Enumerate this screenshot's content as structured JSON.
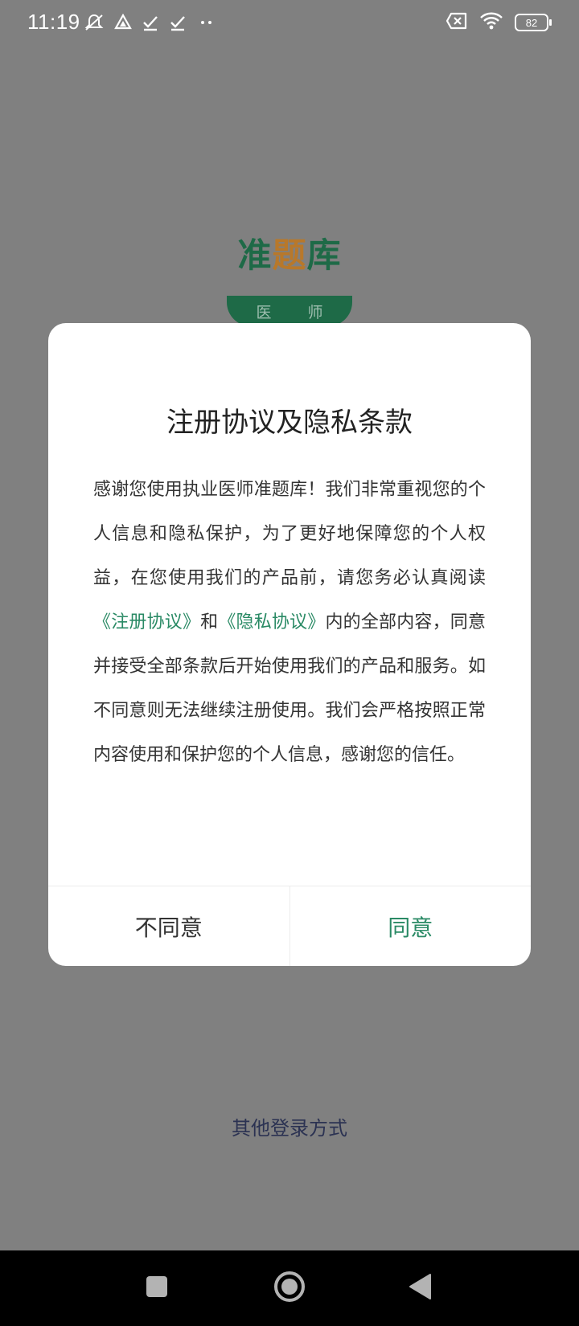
{
  "status_bar": {
    "time": "11:19",
    "battery": "82",
    "icons": [
      "mute-icon",
      "drive-icon",
      "check-icon",
      "check-icon",
      "more-dots-icon",
      "sim-error-icon",
      "wifi-icon",
      "battery-icon"
    ]
  },
  "logo": {
    "text_a": "准",
    "text_b": "题",
    "text_c": "库",
    "badge_left": "医",
    "badge_right": "师"
  },
  "dialog": {
    "title": "注册协议及隐私条款",
    "body_part1": "感谢您使用执业医师准题库！我们非常重视您的个人信息和隐私保护，为了更好地保障您的个人权益，在您使用我们的产品前，请您务必认真阅读",
    "link_register": "《注册协议》",
    "body_and": "和",
    "link_privacy": "《隐私协议》",
    "body_part2": "内的全部内容，同意并接受全部条款后开始使用我们的产品和服务。如不同意则无法继续注册使用。我们会严格按照正常内容使用和保护您的个人信息，感谢您的信任。",
    "disagree_label": "不同意",
    "agree_label": "同意"
  },
  "other_login": "其他登录方式",
  "colors": {
    "accent": "#2a8a65",
    "brand_green": "#1e6a47",
    "brand_orange": "#b8782a",
    "overlay": "#808080"
  }
}
